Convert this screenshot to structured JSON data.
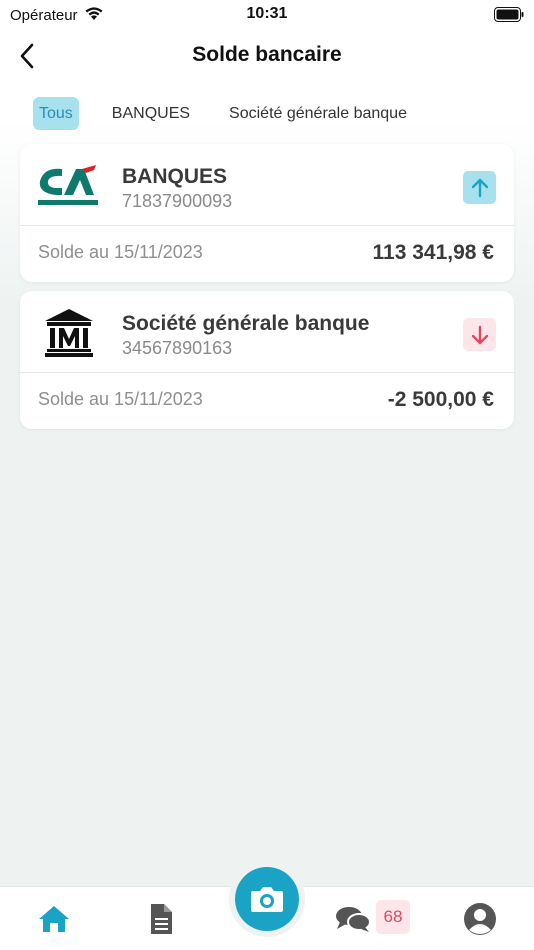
{
  "status_bar": {
    "carrier": "Opérateur",
    "time": "10:31"
  },
  "header": {
    "title": "Solde bancaire"
  },
  "tabs": [
    {
      "label": "Tous",
      "active": true
    },
    {
      "label": "BANQUES",
      "active": false
    },
    {
      "label": "Société générale banque",
      "active": false
    }
  ],
  "accounts": [
    {
      "name": "BANQUES",
      "number": "71837900093",
      "date_label": "Solde au 15/11/2023",
      "amount": "113 341,98 €",
      "trend": "up",
      "logo": "credit-agricole-logo"
    },
    {
      "name": "Société générale banque",
      "number": "34567890163",
      "date_label": "Solde au 15/11/2023",
      "amount": "-2 500,00 €",
      "trend": "down",
      "logo": "bank-building-icon"
    }
  ],
  "bottom_nav": {
    "messages_badge": "68",
    "items": [
      "home-icon",
      "document-icon",
      "camera-icon",
      "chat-icon",
      "user-icon"
    ]
  },
  "colors": {
    "accent": "#1ba3c6",
    "active_tab_bg": "#a8e1ee",
    "down_bg": "#fde6ea",
    "down_arrow": "#e04860",
    "ca_green": "#0d7a6b",
    "ca_red": "#d8232a"
  }
}
